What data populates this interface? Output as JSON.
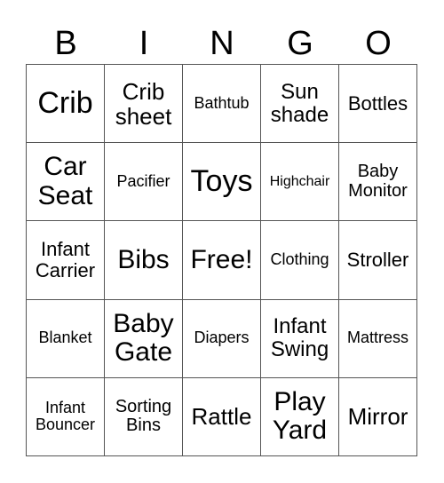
{
  "header": [
    "B",
    "I",
    "N",
    "G",
    "O"
  ],
  "cells": [
    [
      "Crib",
      "Crib sheet",
      "Bathtub",
      "Sun shade",
      "Bottles"
    ],
    [
      "Car Seat",
      "Pacifier",
      "Toys",
      "Highchair",
      "Baby Monitor"
    ],
    [
      "Infant Carrier",
      "Bibs",
      "Free!",
      "Clothing",
      "Stroller"
    ],
    [
      "Blanket",
      "Baby Gate",
      "Diapers",
      "Infant Swing",
      "Mattress"
    ],
    [
      "Infant Bouncer",
      "Sorting Bins",
      "Rattle",
      "Play Yard",
      "Mirror"
    ]
  ]
}
